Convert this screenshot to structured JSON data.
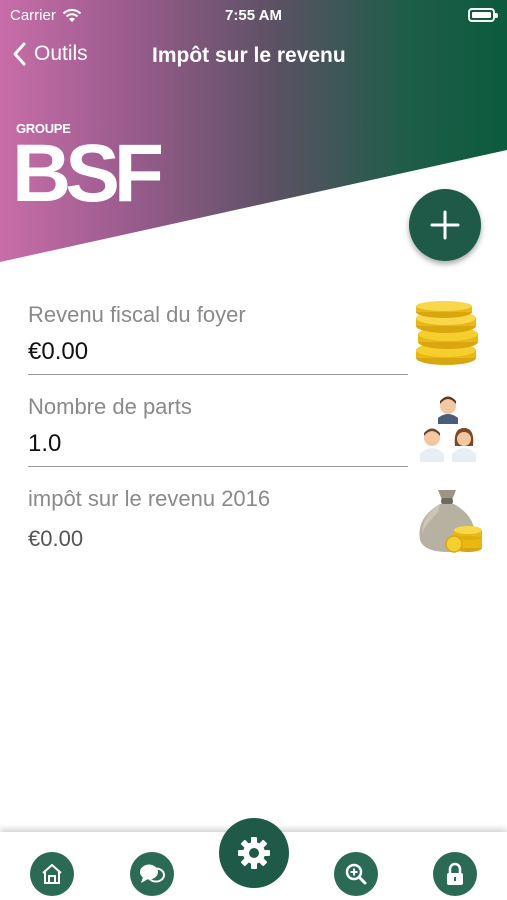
{
  "status_bar": {
    "carrier": "Carrier",
    "time": "7:55 AM"
  },
  "nav": {
    "back_label": "Outils",
    "title": "Impôt sur le revenu"
  },
  "logo": {
    "sub": "GROUPE",
    "main": "BSF"
  },
  "fields": {
    "income": {
      "label": "Revenu fiscal du foyer",
      "value": "€0.00",
      "icon": "coins-icon"
    },
    "parts": {
      "label": "Nombre de parts",
      "value": "1.0",
      "icon": "family-icon"
    },
    "tax": {
      "label": "impôt sur le revenu 2016",
      "value": "€0.00",
      "icon": "money-bag-icon"
    }
  },
  "tab_bar": {
    "items": [
      "home-icon",
      "chat-icon",
      "settings-icon",
      "search-zoom-icon",
      "lock-icon"
    ]
  },
  "colors": {
    "accent_green": "#1e5a47",
    "gradient_pink": "#c86da8",
    "gold": "#f2c318"
  }
}
